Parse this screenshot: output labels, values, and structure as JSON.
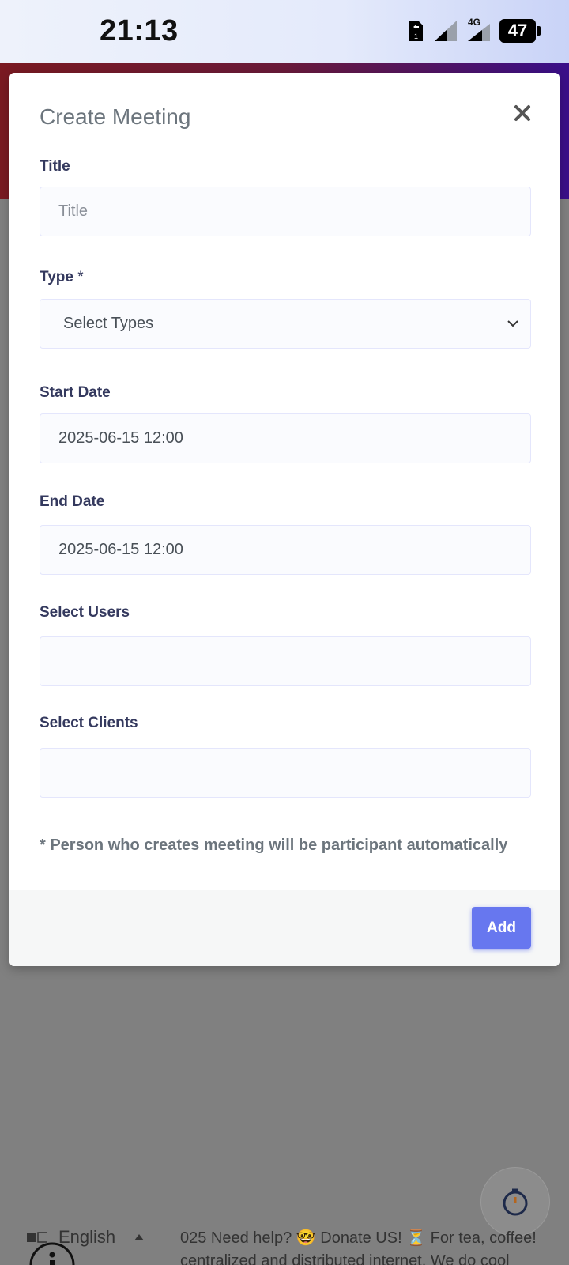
{
  "status_bar": {
    "time": "21:13",
    "network_label": "4G",
    "battery_level": "47",
    "icons": [
      "sim-swap-icon",
      "signal-icon",
      "signal-4g-icon",
      "battery-icon"
    ]
  },
  "modal": {
    "title": "Create Meeting",
    "close_icon": "close-icon",
    "fields": {
      "title": {
        "label": "Title",
        "placeholder": "Title",
        "value": ""
      },
      "type": {
        "label": "Type",
        "required_mark": "*",
        "selected": "Select Types"
      },
      "start_date": {
        "label": "Start Date",
        "value": "2025-06-15 12:00"
      },
      "end_date": {
        "label": "End Date",
        "value": "2025-06-15 12:00"
      },
      "select_users": {
        "label": "Select Users",
        "value": ""
      },
      "select_clients": {
        "label": "Select Clients",
        "value": ""
      }
    },
    "note": "* Person who creates meeting will be participant automatically",
    "footer": {
      "add_label": "Add"
    }
  },
  "colors": {
    "primary": "#6777ef",
    "label": "#34395e",
    "muted": "#6c757d"
  },
  "bottom": {
    "language": "English",
    "marquee_line1": "025 Need help? 🤓 Donate US! ⏳ For tea, coffee!",
    "marquee_line2": "centralized and distributed internet. We do cool"
  }
}
